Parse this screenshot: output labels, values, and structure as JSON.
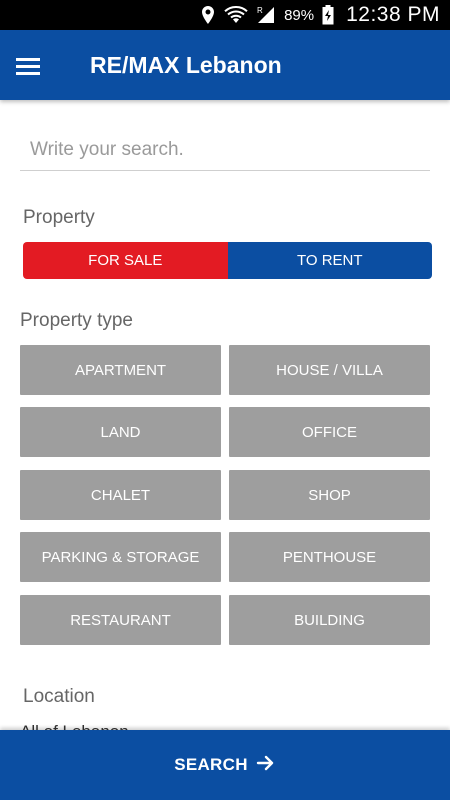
{
  "status_bar": {
    "battery": "89%",
    "time": "12:38 PM",
    "icons": [
      "location-icon",
      "wifi-icon",
      "signal-icon",
      "battery-charging-icon"
    ]
  },
  "app_bar": {
    "title": "RE/MAX Lebanon",
    "menu_icon": "hamburger-menu-icon"
  },
  "search": {
    "placeholder": "Write your search.",
    "value": ""
  },
  "property": {
    "label": "Property",
    "options": [
      {
        "label": "FOR SALE",
        "color": "#e31b23"
      },
      {
        "label": "TO RENT",
        "color": "#0b4ea2"
      }
    ]
  },
  "property_type": {
    "label": "Property type",
    "options": [
      "APARTMENT",
      "HOUSE / VILLA",
      "LAND",
      "OFFICE",
      "CHALET",
      "SHOP",
      "PARKING & STORAGE",
      "PENTHOUSE",
      "RESTAURANT",
      "BUILDING"
    ]
  },
  "location": {
    "label": "Location",
    "value": "All of Lebanon"
  },
  "bottom_bar": {
    "search_label": "SEARCH",
    "arrow_icon": "arrow-right-icon"
  },
  "colors": {
    "brand_blue": "#0b4ea2",
    "brand_red": "#e31b23",
    "type_button_gray": "#9e9e9e"
  }
}
